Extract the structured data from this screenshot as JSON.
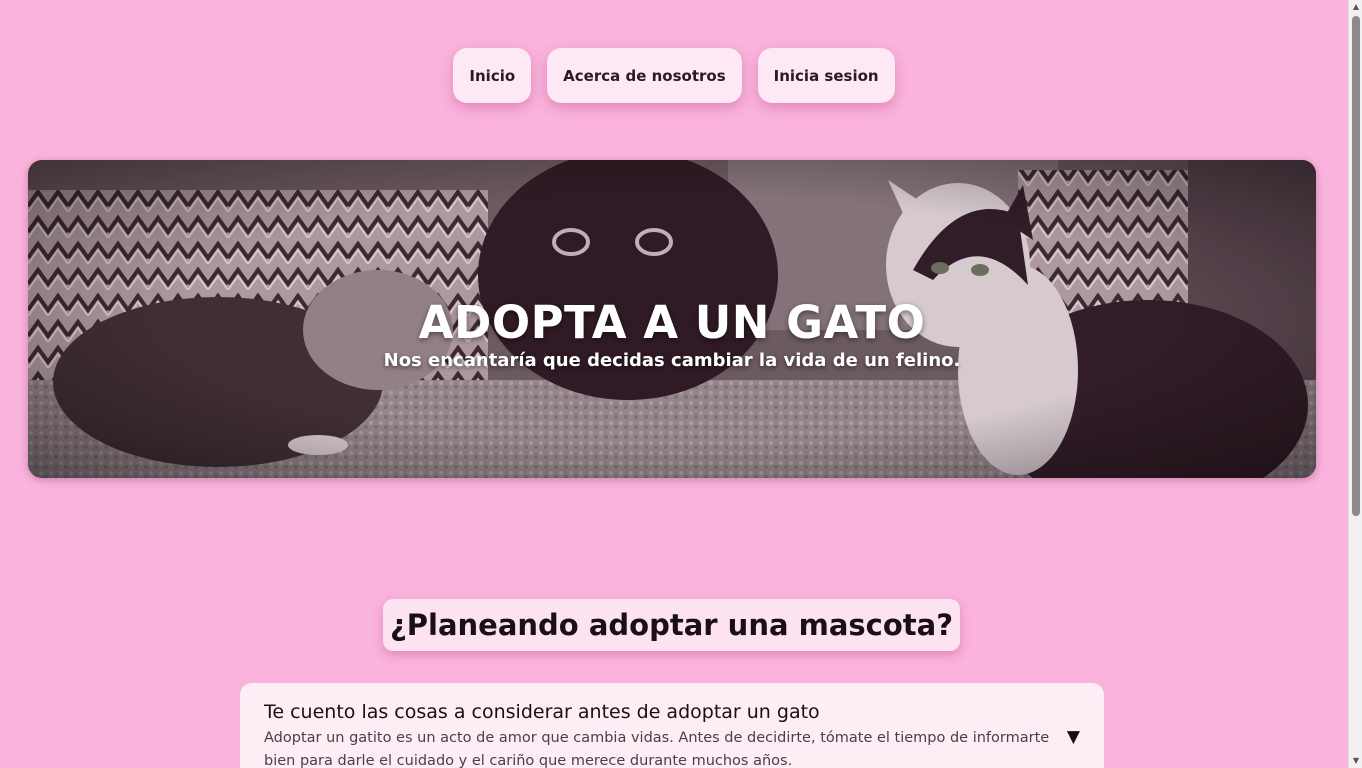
{
  "nav": {
    "items": [
      {
        "label": "Inicio"
      },
      {
        "label": "Acerca de nosotros"
      },
      {
        "label": "Inicia sesion"
      }
    ]
  },
  "hero": {
    "title": "ADOPTA A UN GATO",
    "subtitle": "Nos encantaría que decidas cambiar la vida de un felino."
  },
  "section": {
    "heading": "¿Planeando adoptar una mascota?"
  },
  "card": {
    "title": "Te cuento las cosas a considerar antes de adoptar un gato",
    "body": "Adoptar un gatito es un acto de amor que cambia vidas. Antes de decidirte, tómate el tiempo de informarte bien para darle el cuidado y el cariño que merece durante muchos años.",
    "toggle_icon": "▼"
  },
  "colors": {
    "background": "#f9b3dc",
    "button_bg": "#fde8f4",
    "card_bg": "#fdeef6"
  }
}
